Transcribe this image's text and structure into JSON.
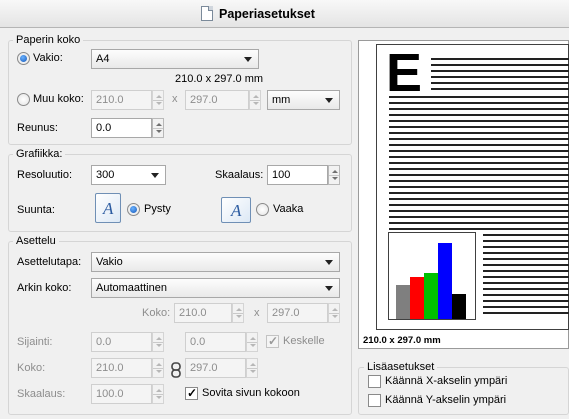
{
  "window": {
    "title": "Paperiasetukset"
  },
  "paper_size": {
    "legend": "Paperin koko",
    "standard_label": "Vakio:",
    "standard_value": "A4",
    "dimensions": "210.0 x 297.0 mm",
    "custom_label": "Muu koko:",
    "custom_width": "210.0",
    "custom_x": "x",
    "custom_height": "297.0",
    "unit": "mm",
    "margin_label": "Reunus:",
    "margin_value": "0.0"
  },
  "graphics": {
    "legend": "Grafiikka:",
    "resolution_label": "Resoluutio:",
    "resolution_value": "300",
    "scale_label": "Skaalaus:",
    "scale_value": "100",
    "orientation_label": "Suunta:",
    "portrait_label": "Pysty",
    "landscape_label": "Vaaka",
    "orientation_icon_glyph": "A"
  },
  "layout": {
    "legend": "Asettelu",
    "layout_mode_label": "Asettelutapa:",
    "layout_mode_value": "Vakio",
    "sheet_size_label": "Arkin koko:",
    "sheet_size_value": "Automaattinen",
    "size_label": "Koko:",
    "size_width": "210.0",
    "size_x": "x",
    "size_height": "297.0",
    "position_label": "Sijainti:",
    "position_x": "0.0",
    "position_y": "0.0",
    "center_label": "Keskelle",
    "dim_label": "Koko:",
    "dim_width": "210.0",
    "dim_height": "297.0",
    "scaling_label": "Skaalaus:",
    "scaling_value": "100.0",
    "fit_label": "Sovita sivun kokoon"
  },
  "preview": {
    "letter": "E",
    "caption": "210.0 x 297.0 mm",
    "bar_colors": [
      "#7f7f7f",
      "#ff0000",
      "#00c000",
      "#0000ff",
      "#000000"
    ],
    "bar_levels": [
      0.4,
      0.5,
      0.55,
      0.9,
      0.3
    ]
  },
  "extra": {
    "legend": "Lisäasetukset",
    "flip_x_label": "Käännä X-akselin ympäri",
    "flip_y_label": "Käännä Y-akselin ympäri"
  },
  "icons": {
    "title": "document-icon",
    "portrait": "portrait-orientation-icon",
    "landscape": "landscape-orientation-icon",
    "link": "chain-link-icon"
  },
  "marks": {
    "check": "✓"
  }
}
